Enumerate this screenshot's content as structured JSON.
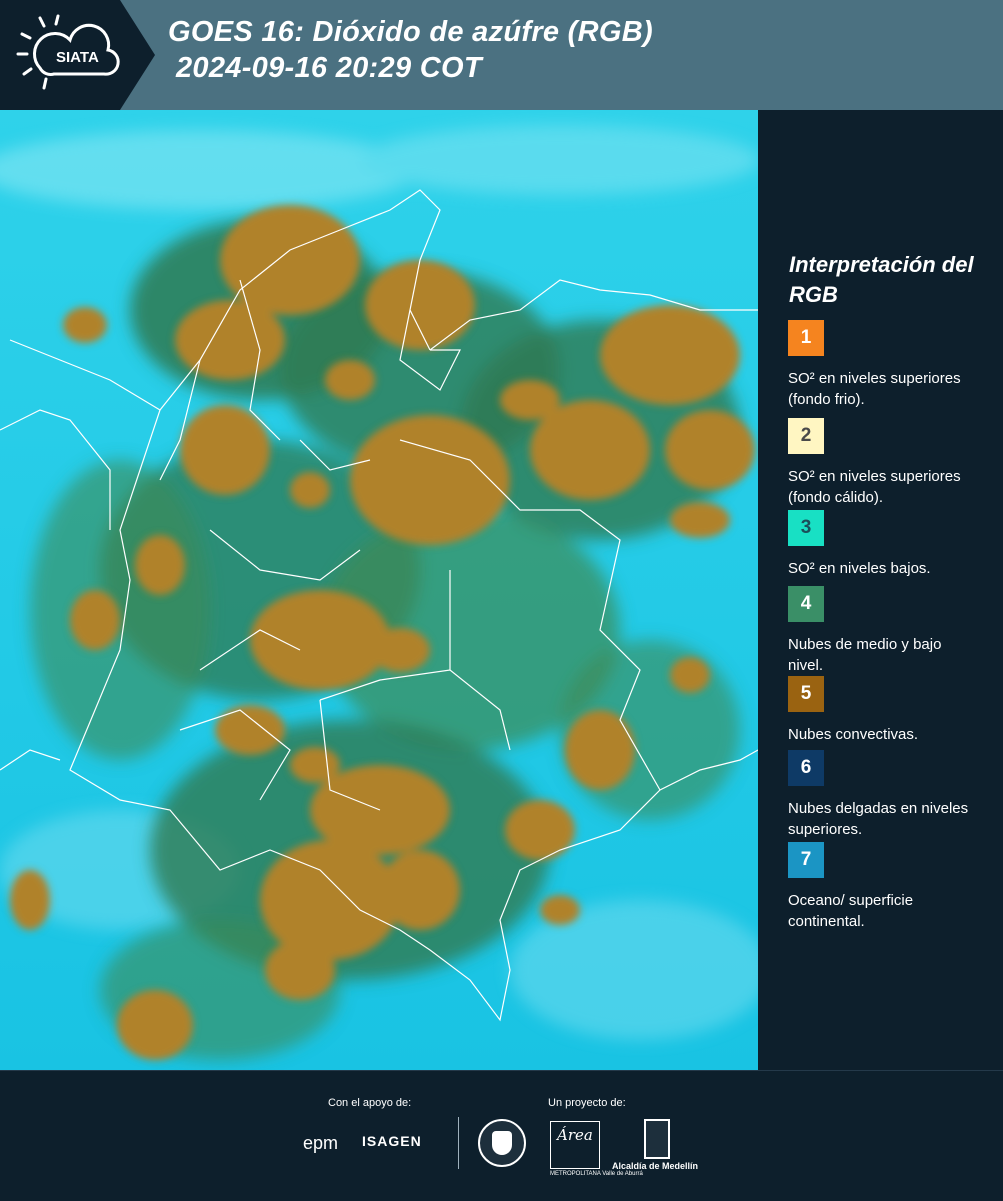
{
  "header": {
    "logo_text": "SIATA",
    "title_line1": "GOES 16: Dióxido de azúfre (RGB)",
    "title_line2": "2024-09-16 20:29 COT"
  },
  "legend": {
    "title": "Interpretación del RGB",
    "items": [
      {
        "num": "1",
        "color": "#f5841f",
        "num_color": "#ffffff",
        "text": "SO² en niveles superiores (fondo frio)."
      },
      {
        "num": "2",
        "color": "#fff6c2",
        "num_color": "#4a4a4a",
        "text": "SO² en niveles superiores (fondo cálido)."
      },
      {
        "num": "3",
        "color": "#18e0c4",
        "num_color": "#1b4f5a",
        "text": "SO² en niveles bajos."
      },
      {
        "num": "4",
        "color": "#3a8f67",
        "num_color": "#ffffff",
        "text": "Nubes de medio y bajo nivel."
      },
      {
        "num": "5",
        "color": "#9a6311",
        "num_color": "#ffffff",
        "text": "Nubes convectivas."
      },
      {
        "num": "6",
        "color": "#0e3a66",
        "num_color": "#ffffff",
        "text": "Nubes delgadas en niveles superiores."
      },
      {
        "num": "7",
        "color": "#1b95c4",
        "num_color": "#ffffff",
        "text": "Oceano/ superficie continental."
      }
    ]
  },
  "footer": {
    "support_label": "Con el apoyo de:",
    "project_label": "Un proyecto de:",
    "epm": "epm",
    "isagen": "ISAGEN",
    "area_logo": "Área",
    "area_sub": "METROPOLITANA Valle de Aburrá",
    "alcaldia": "Alcaldía de Medellín"
  },
  "colors": {
    "header_bg": "#4b7181",
    "panel_bg": "#0d1f2c",
    "map_ocean": "#20c9e6",
    "map_cloud": "#b0822a",
    "map_green": "#2f7a52"
  }
}
